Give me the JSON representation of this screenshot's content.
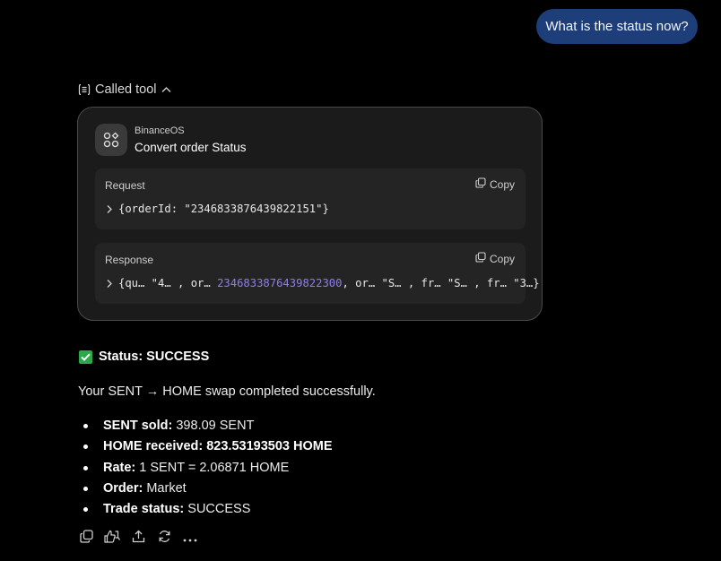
{
  "user_message": "What is the status now?",
  "called_tool": {
    "label": "Called tool"
  },
  "tool": {
    "provider": "BinanceOS",
    "action": "Convert order Status",
    "request": {
      "label": "Request",
      "copy_label": "Copy",
      "body": "{orderId: \"2346833876439822151\"}"
    },
    "response": {
      "label": "Response",
      "copy_label": "Copy",
      "part1": "{qu… \"4… , or… ",
      "number": "2346833876439822300",
      "part2": ", or… \"S… , fr… \"S… , fr… \"3…}"
    }
  },
  "result": {
    "status_label": "Status: SUCCESS",
    "summary": "Your SENT → HOME swap completed successfully.",
    "bullets": [
      {
        "key": "SENT sold:",
        "value": " 398.09 SENT"
      },
      {
        "key": "HOME received: 823.53193503 HOME",
        "value": ""
      },
      {
        "key": "Rate:",
        "value": " 1 SENT = 2.06871 HOME"
      },
      {
        "key": "Order:",
        "value": " Market"
      },
      {
        "key": "Trade status:",
        "value": " SUCCESS"
      }
    ]
  },
  "colors": {
    "user_bubble": "#1d3e78",
    "accent_number": "#8f7df0",
    "check": "#2ba84a"
  },
  "icons": [
    "tool-list-icon",
    "chevron-up-icon",
    "binance-os-icon",
    "copy-icon",
    "chevron-right-icon",
    "check-icon",
    "thumbs-up-icon",
    "thumbs-down-icon",
    "share-icon",
    "regenerate-icon",
    "more-icon"
  ]
}
